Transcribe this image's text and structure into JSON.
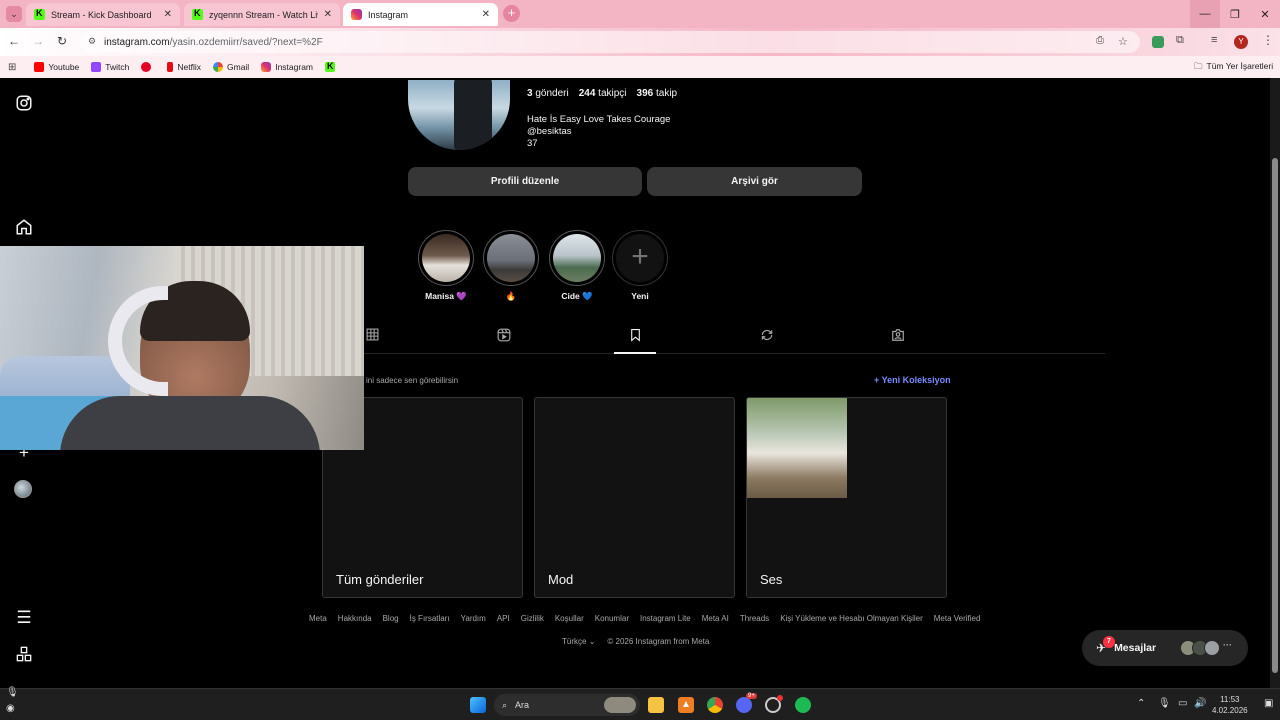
{
  "browser": {
    "tabs": [
      {
        "title": "Stream - Kick Dashboard",
        "active": false
      },
      {
        "title": "zyqennn Stream - Watch Live o",
        "active": false
      },
      {
        "title": "Instagram",
        "active": true
      }
    ],
    "url_host": "instagram.com",
    "url_path": "/yasin.ozdemiirr/saved/?next=%2F",
    "profile_initial": "Y",
    "bookmarks": [
      "Youtube",
      "Twitch",
      "Netflix",
      "Gmail",
      "Instagram"
    ],
    "all_bookmarks": "Tüm Yer İşaretleri"
  },
  "profile": {
    "posts_count": "3",
    "posts_label": "gönderi",
    "followers_count": "244",
    "followers_label": "takipçi",
    "following_count": "396",
    "following_label": "takip",
    "bio_lines": [
      "Hate İs Easy Love Takes Courage",
      "@besiktas",
      "37"
    ],
    "edit_profile": "Profili düzenle",
    "view_archive": "Arşivi gör"
  },
  "highlights": [
    {
      "label": "Manisa 💜"
    },
    {
      "label": "🔥"
    },
    {
      "label": "Cide 💙"
    },
    {
      "label": "Yeni"
    }
  ],
  "saved": {
    "private_note": "ini sadece sen görebilirsin",
    "new_collection": "+ Yeni Koleksiyon",
    "collections": [
      {
        "name": "Tüm gönderiler"
      },
      {
        "name": "Mod"
      },
      {
        "name": "Ses"
      }
    ]
  },
  "footer": {
    "links": [
      "Meta",
      "Hakkında",
      "Blog",
      "İş Fırsatları",
      "Yardım",
      "API",
      "Gizlilik",
      "Koşullar",
      "Konumlar",
      "Instagram Lite",
      "Meta AI",
      "Threads",
      "Kişi Yükleme ve Hesabı Olmayan Kişiler",
      "Meta Verified"
    ],
    "language": "Türkçe",
    "copyright": "© 2026 Instagram from Meta"
  },
  "messages": {
    "label": "Mesajlar",
    "badge": "7"
  },
  "taskbar": {
    "search_placeholder": "Ara",
    "discord_badge": "9+",
    "time": "11:53",
    "date": "4.02.2026"
  },
  "colors": {
    "tab_bar": "#f3b4c4",
    "ig_background": "#000000",
    "button_bg": "#363636",
    "link_blue": "#7a8bff"
  }
}
